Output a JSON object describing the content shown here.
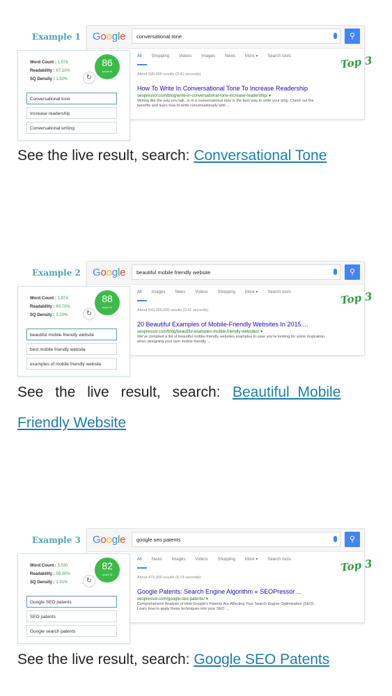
{
  "google_logo": "Google",
  "top_badge": "Top 3",
  "caption_prefix": "See the live result, search:",
  "examples": [
    {
      "label": "Example 1",
      "query": "conversational tone",
      "tabs": [
        "All",
        "Shopping",
        "Videos",
        "Images",
        "News",
        "More ▾",
        "Search tools"
      ],
      "stats": "About 935,000 results (0.41 seconds)",
      "result_title": "How To Write In Conversational Tone To Increase Readership",
      "result_url": "seopressor.com/blog/write-in-conversational-tone-increase-readership/ ▾",
      "result_desc": "Writing like the way you talk, or in a conversational tone is the best way to write your blog. Check out the benefits and learn how to write conversationally with ...",
      "word_count_label": "Word Count :",
      "word_count": "1,578",
      "readability_label": "Readability :",
      "readability": "67.10%",
      "density_label": "SQ Density :",
      "density": "1.92%",
      "score": "86",
      "score_label": "score %",
      "keywords": [
        "Conversational tone",
        "Increase readership",
        "Conversational writing"
      ],
      "link_text": "Conversational Tone"
    },
    {
      "label": "Example 2",
      "query": "beautiful mobile friendly website",
      "tabs": [
        "All",
        "Images",
        "News",
        "Videos",
        "Shopping",
        "More ▾",
        "Search tools"
      ],
      "stats": "About 543,000,000 results (0.41 seconds)",
      "result_title": "20 Beautiful Examples of Mobile-Friendly Websites In 2015 ...",
      "result_url": "seopressor.com/blog/beautiful-examples-mobile-friendly-websites/ ▾",
      "result_desc": "We've compiled a list of beautiful mobile-friendly websites examples in case you're looking for some inspiration when designing your own mobile friendly ...",
      "word_count_label": "Word Count :",
      "word_count": "1,874",
      "readability_label": "Readability :",
      "readability": "65.70%",
      "density_label": "SQ Density :",
      "density": "3.20%",
      "score": "88",
      "score_label": "score %",
      "keywords": [
        "beautiful mobile friendly website",
        "best mobile friendly website",
        "examples of mobile friendly website"
      ],
      "link_text_line1": "Beautiful Mobile",
      "link_text_line2": "Friendly Website"
    },
    {
      "label": "Example 3",
      "query": "google seo patents",
      "tabs": [
        "All",
        "News",
        "Images",
        "Videos",
        "Shopping",
        "More ▾",
        "Search tools"
      ],
      "stats": "About 473,000 results (0.73 seconds)",
      "result_title": "Google Patents: Search Engine Algorithm « SEOPressor ...",
      "result_url": "seopressor.com/google-seo-patents/ ▾",
      "result_desc": "Comprehensive Analysis of How Google's Patents Are Affecting Your Search Engine Optimization (SEO). Learn how to apply these techniques into your SEO ...",
      "word_count_label": "Word Count :",
      "word_count": "5,530",
      "readability_label": "Readability :",
      "readability": "59.00%",
      "density_label": "SQ Density :",
      "density": "1.91%",
      "score": "82",
      "score_label": "score %",
      "keywords": [
        "Google SEO patents",
        "SEO patents",
        "Google search patents"
      ],
      "link_text": "Google SEO Patents"
    }
  ],
  "colors": {
    "link": "#1d7ea6",
    "score_green": "#3dbb4a",
    "google_blue": "#4285f4",
    "top3_green": "#2f9e44",
    "label_teal": "#4fa3b5"
  }
}
